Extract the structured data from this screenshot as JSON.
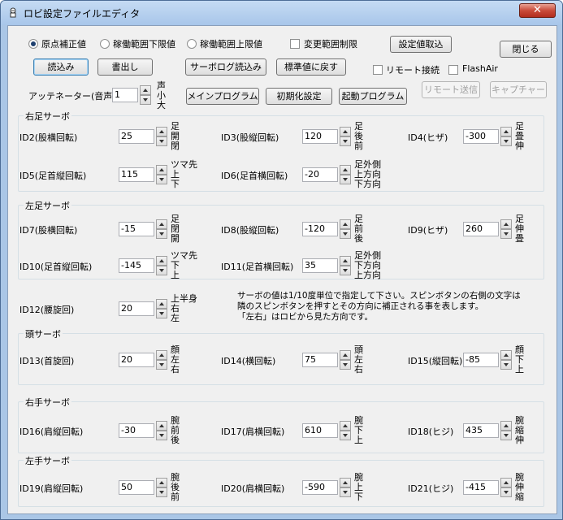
{
  "window": {
    "title": "ロビ設定ファイルエディタ",
    "close_glyph": "✕"
  },
  "mode_radios": [
    {
      "label": "原点補正値",
      "selected": true
    },
    {
      "label": "稼働範囲下限値",
      "selected": false
    },
    {
      "label": "稼働範囲上限値",
      "selected": false
    }
  ],
  "change_limit": {
    "label": "変更範囲制限",
    "checked": false
  },
  "buttons": {
    "load_settings": "設定値取込",
    "close": "閉じる",
    "read": "読込み",
    "write": "書出し",
    "servo_log": "サーボログ読込み",
    "reset_std": "標準値に戻す",
    "main_program": "メインプログラム",
    "init_settings": "初期化設定",
    "boot_program": "起動プログラム",
    "remote_send": "リモート送信",
    "capture": "キャプチャー"
  },
  "remote_connect": {
    "label": "リモート接続",
    "checked": false
  },
  "flash_air": {
    "label": "FlashAir",
    "checked": false
  },
  "attenuator": {
    "label": "アッテネーター(音声)",
    "value": "1",
    "side": "声 小 大"
  },
  "groups": {
    "right_leg": "右足サーボ",
    "left_leg": "左足サーボ",
    "head": "頭サーボ",
    "right_arm": "右手サーボ",
    "left_arm": "左手サーボ"
  },
  "servos": [
    {
      "id": "ID2",
      "label": "ID2(股横回転)",
      "value": "25",
      "dir": [
        "足",
        "開",
        "閉"
      ]
    },
    {
      "id": "ID3",
      "label": "ID3(股縦回転)",
      "value": "120",
      "dir": [
        "足",
        "後",
        "前"
      ]
    },
    {
      "id": "ID4",
      "label": "ID4(ヒザ)",
      "value": "-300",
      "dir": [
        "足",
        "畳",
        "伸"
      ]
    },
    {
      "id": "ID5",
      "label": "ID5(足首縦回転)",
      "value": "115",
      "dir": [
        "ツマ先",
        "上",
        "下"
      ]
    },
    {
      "id": "ID6",
      "label": "ID6(足首横回転)",
      "value": "-20",
      "dir": [
        "足外側",
        "上方向",
        "下方向"
      ]
    },
    {
      "id": "ID7",
      "label": "ID7(股横回転)",
      "value": "-15",
      "dir": [
        "足",
        "閉",
        "開"
      ]
    },
    {
      "id": "ID8",
      "label": "ID8(股縦回転)",
      "value": "-120",
      "dir": [
        "足",
        "前",
        "後"
      ]
    },
    {
      "id": "ID9",
      "label": "ID9(ヒザ)",
      "value": "260",
      "dir": [
        "足",
        "伸",
        "畳"
      ]
    },
    {
      "id": "ID10",
      "label": "ID10(足首縦回転)",
      "value": "-145",
      "dir": [
        "ツマ先",
        "下",
        "上"
      ]
    },
    {
      "id": "ID11",
      "label": "ID11(足首横回転)",
      "value": "35",
      "dir": [
        "足外側",
        "下方向",
        "上方向"
      ]
    },
    {
      "id": "ID12",
      "label": "ID12(腰旋回)",
      "value": "20",
      "dir": [
        "上半身",
        "右",
        "左"
      ]
    },
    {
      "id": "ID13",
      "label": "ID13(首旋回)",
      "value": "20",
      "dir": [
        "顔",
        "左",
        "右"
      ]
    },
    {
      "id": "ID14",
      "label": "ID14(横回転)",
      "value": "75",
      "dir": [
        "頭",
        "左",
        "右"
      ]
    },
    {
      "id": "ID15",
      "label": "ID15(縦回転)",
      "value": "-85",
      "dir": [
        "顔",
        "下",
        "上"
      ]
    },
    {
      "id": "ID16",
      "label": "ID16(肩縦回転)",
      "value": "-30",
      "dir": [
        "腕",
        "前",
        "後"
      ]
    },
    {
      "id": "ID17",
      "label": "ID17(肩横回転)",
      "value": "610",
      "dir": [
        "腕",
        "下",
        "上"
      ]
    },
    {
      "id": "ID18",
      "label": "ID18(ヒジ)",
      "value": "435",
      "dir": [
        "腕",
        "縮",
        "伸"
      ]
    },
    {
      "id": "ID19",
      "label": "ID19(肩縦回転)",
      "value": "50",
      "dir": [
        "腕",
        "後",
        "前"
      ]
    },
    {
      "id": "ID20",
      "label": "ID20(肩横回転)",
      "value": "-590",
      "dir": [
        "腕",
        "上",
        "下"
      ]
    },
    {
      "id": "ID21",
      "label": "ID21(ヒジ)",
      "value": "-415",
      "dir": [
        "腕",
        "伸",
        "縮"
      ]
    }
  ],
  "note": [
    "サーボの値は1/10度単位で指定して下さい。スピンボタンの右側の文字は",
    "隣のスピンボタンを押すとその方向に補正される事を表します。",
    "「左右」はロビから見た方向です。"
  ]
}
